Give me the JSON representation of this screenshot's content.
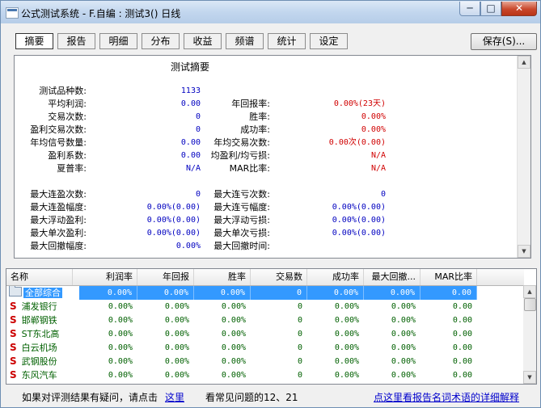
{
  "window": {
    "title": "公式测试系统 - F.自编 : 测试3() 日线",
    "min": "─",
    "max": "□",
    "close": "✕"
  },
  "tabs": [
    "摘要",
    "报告",
    "明细",
    "分布",
    "收益",
    "频谱",
    "统计",
    "设定"
  ],
  "save_button": "保存(S)...",
  "summary": {
    "title": "测试摘要",
    "left": [
      {
        "label": "测试品种数:",
        "value": "1133"
      },
      {
        "label": "平均利润:",
        "value": "0.00"
      },
      {
        "label": "交易次数:",
        "value": "0"
      },
      {
        "label": "盈利交易次数:",
        "value": "0"
      },
      {
        "label": "年均信号数量:",
        "value": "0.00"
      },
      {
        "label": "盈利系数:",
        "value": "0.00"
      },
      {
        "label": "夏普率:",
        "value": "N/A"
      }
    ],
    "right": [
      {
        "label": "年回报率:",
        "value": "0.00%(23天)"
      },
      {
        "label": "胜率:",
        "value": "0.00%"
      },
      {
        "label": "成功率:",
        "value": "0.00%"
      },
      {
        "label": "年均交易次数:",
        "value": "0.00次(0.00)"
      },
      {
        "label": "均盈利/均亏损:",
        "value": "N/A"
      },
      {
        "label": "MAR比率:",
        "value": "N/A"
      }
    ],
    "left2": [
      {
        "label": "最大连盈次数:",
        "value": "0"
      },
      {
        "label": "最大连盈幅度:",
        "value": "0.00%(0.00)"
      },
      {
        "label": "最大浮动盈利:",
        "value": "0.00%(0.00)"
      },
      {
        "label": "最大单次盈利:",
        "value": "0.00%(0.00)"
      },
      {
        "label": "最大回撤幅度:",
        "value": "0.00%"
      }
    ],
    "right2": [
      {
        "label": "最大连亏次数:",
        "value": "0"
      },
      {
        "label": "最大连亏幅度:",
        "value": "0.00%(0.00)"
      },
      {
        "label": "最大浮动亏损:",
        "value": "0.00%(0.00)"
      },
      {
        "label": "最大单次亏损:",
        "value": "0.00%(0.00)"
      },
      {
        "label": "最大回撤时间:",
        "value": ""
      }
    ]
  },
  "table": {
    "columns": [
      "名称",
      "利润率",
      "年回报",
      "胜率",
      "交易数",
      "成功率",
      "最大回撤...",
      "MAR比率"
    ],
    "rows": [
      {
        "name": "全部综合",
        "icon": "folder-icon",
        "values": [
          "0.00%",
          "0.00%",
          "0.00%",
          "0",
          "0.00%",
          "0.00%",
          "0.00"
        ]
      },
      {
        "name": "浦发银行",
        "icon": "s",
        "values": [
          "0.00%",
          "0.00%",
          "0.00%",
          "0",
          "0.00%",
          "0.00%",
          "0.00"
        ]
      },
      {
        "name": "邯郸钢铁",
        "icon": "s",
        "values": [
          "0.00%",
          "0.00%",
          "0.00%",
          "0",
          "0.00%",
          "0.00%",
          "0.00"
        ]
      },
      {
        "name": "ST东北高",
        "icon": "s",
        "values": [
          "0.00%",
          "0.00%",
          "0.00%",
          "0",
          "0.00%",
          "0.00%",
          "0.00"
        ]
      },
      {
        "name": "白云机场",
        "icon": "s",
        "values": [
          "0.00%",
          "0.00%",
          "0.00%",
          "0",
          "0.00%",
          "0.00%",
          "0.00"
        ]
      },
      {
        "name": "武钢股份",
        "icon": "s",
        "values": [
          "0.00%",
          "0.00%",
          "0.00%",
          "0",
          "0.00%",
          "0.00%",
          "0.00"
        ]
      },
      {
        "name": "东风汽车",
        "icon": "s",
        "values": [
          "0.00%",
          "0.00%",
          "0.00%",
          "0",
          "0.00%",
          "0.00%",
          "0.00"
        ]
      }
    ]
  },
  "status": {
    "prompt": "如果对评测结果有疑问，请点击",
    "here_link": "这里",
    "faq": "看常见问题的12、21",
    "glossary_link": "点这里看报告名词术语的详细解释"
  },
  "icons": {
    "stock_marker": "S",
    "scroll_up": "▲",
    "scroll_down": "▼"
  }
}
